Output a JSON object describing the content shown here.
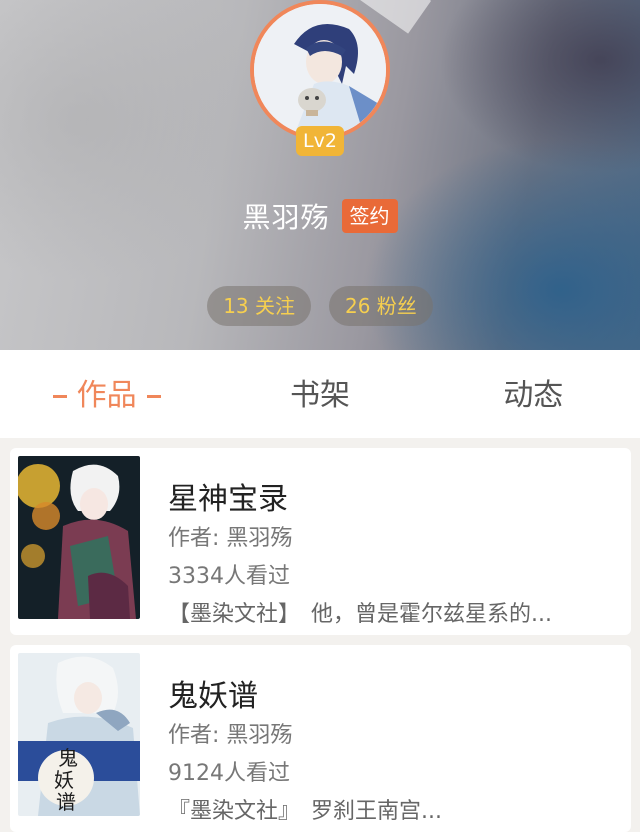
{
  "profile": {
    "level": "Lv2",
    "username": "黑羽殇",
    "signed_label": "签约",
    "following": "13 关注",
    "followers": "26 粉丝"
  },
  "tabs": [
    {
      "label": "作品",
      "active": true
    },
    {
      "label": "书架",
      "active": false
    },
    {
      "label": "动态",
      "active": false
    }
  ],
  "books": [
    {
      "title": "星神宝录",
      "author": "作者: 黑羽殇",
      "views": "3334人看过",
      "desc": "【墨染文社】　他，曾是霍尔兹星系的..."
    },
    {
      "title": "鬼妖谱",
      "author": "作者: 黑羽殇",
      "views": "9124人看过",
      "desc": "『墨染文社』　罗刹王南宫..."
    }
  ],
  "colors": {
    "accent": "#f0875a",
    "level_badge": "#f1b537",
    "signed_badge": "#e96a38",
    "stat_text": "#f6cf4f"
  }
}
